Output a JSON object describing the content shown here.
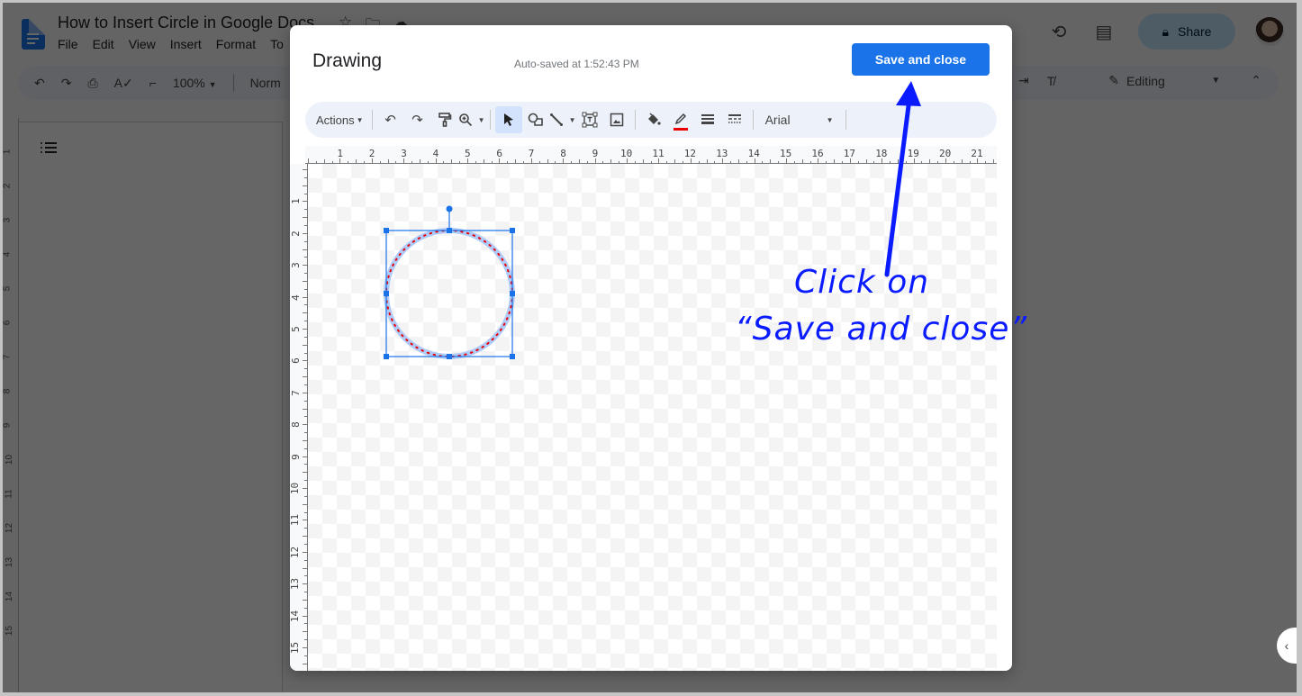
{
  "docs": {
    "title": "How to Insert Circle in Google Docs",
    "title_icons": [
      "star-icon",
      "move-folder-icon",
      "cloud-status-icon"
    ],
    "menu": [
      "File",
      "Edit",
      "View",
      "Insert",
      "Format",
      "To"
    ],
    "share_label": "Share",
    "toolbar": {
      "zoom": "100%",
      "style": "Norm"
    },
    "mode_label": "Editing",
    "vruler_labels": [
      "1",
      "2",
      "3",
      "4",
      "5",
      "6",
      "7",
      "8",
      "9",
      "10",
      "11",
      "12",
      "13",
      "14",
      "15"
    ]
  },
  "dialog": {
    "title": "Drawing",
    "autosave": "Auto-saved at 1:52:43 PM",
    "save_label": "Save and close",
    "toolbar": {
      "actions_label": "Actions",
      "font": "Arial",
      "line_color": "#ea0000"
    },
    "hruler_labels": [
      "1",
      "2",
      "3",
      "4",
      "5",
      "6",
      "7",
      "8",
      "9",
      "10",
      "11",
      "12",
      "13",
      "14",
      "15",
      "16",
      "17",
      "18",
      "19",
      "20",
      "21"
    ],
    "vruler_labels": [
      "1",
      "2",
      "3",
      "4",
      "5",
      "6",
      "7",
      "8",
      "9",
      "10",
      "11",
      "12",
      "13",
      "14",
      "15"
    ],
    "shape": {
      "type": "circle",
      "selected": true,
      "border_style": "dotted",
      "border_color": "#ea0000"
    }
  },
  "annotation": {
    "line1": "Click on",
    "line2": "“Save and close”",
    "color": "#0a1cff"
  }
}
